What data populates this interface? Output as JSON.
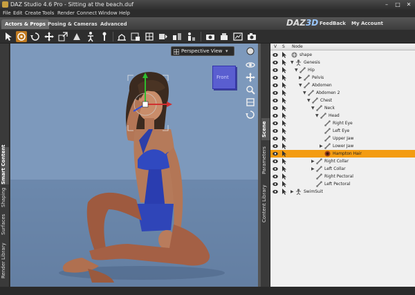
{
  "window": {
    "title": "DAZ Studio 4.6 Pro - Sitting at the beach.duf",
    "minimize": "–",
    "maximize": "□",
    "close": "✕"
  },
  "menu": [
    "File",
    "Edit",
    "Create",
    "Tools",
    "Render",
    "Connect",
    "Window",
    "Help"
  ],
  "tabs": [
    "Actors & Props",
    "Posing & Cameras",
    "Advanced"
  ],
  "logo": {
    "daz": "DAZ",
    "three": "3D"
  },
  "header_links": {
    "feedback": "FeedBack",
    "account": "My Account"
  },
  "left_tabs": [
    "Smart Content",
    "Shaping",
    "Surfaces",
    "Render Library"
  ],
  "viewport": {
    "camera": "Perspective View",
    "cube_label": "Front"
  },
  "panel_tabs": [
    "Scene",
    "Parameters",
    "Content Library"
  ],
  "scene": {
    "columns": {
      "v": "V",
      "s": "S",
      "node": "Node"
    },
    "nodes": [
      {
        "label": "shape",
        "depth": 0,
        "icon": "shape",
        "twisty": ""
      },
      {
        "label": "Genesis",
        "depth": 1,
        "icon": "figure",
        "twisty": "▼"
      },
      {
        "label": "Hip",
        "depth": 2,
        "icon": "bone",
        "twisty": "▼"
      },
      {
        "label": "Pelvis",
        "depth": 3,
        "icon": "bone",
        "twisty": "▶"
      },
      {
        "label": "Abdomen",
        "depth": 3,
        "icon": "bone",
        "twisty": "▼"
      },
      {
        "label": "Abdomen 2",
        "depth": 4,
        "icon": "bone",
        "twisty": "▼"
      },
      {
        "label": "Chest",
        "depth": 5,
        "icon": "bone",
        "twisty": "▼"
      },
      {
        "label": "Neck",
        "depth": 6,
        "icon": "bone",
        "twisty": "▼"
      },
      {
        "label": "Head",
        "depth": 7,
        "icon": "bone",
        "twisty": "▼"
      },
      {
        "label": "Right Eye",
        "depth": 8,
        "icon": "bone",
        "twisty": ""
      },
      {
        "label": "Left Eye",
        "depth": 8,
        "icon": "bone",
        "twisty": ""
      },
      {
        "label": "Upper Jaw",
        "depth": 8,
        "icon": "bone",
        "twisty": ""
      },
      {
        "label": "Lower Jaw",
        "depth": 8,
        "icon": "bone",
        "twisty": "▶"
      },
      {
        "label": "Hampton Hair",
        "depth": 8,
        "icon": "hair",
        "twisty": "",
        "selected": true
      },
      {
        "label": "Right Collar",
        "depth": 6,
        "icon": "bone",
        "twisty": "▶"
      },
      {
        "label": "Left Collar",
        "depth": 6,
        "icon": "bone",
        "twisty": "▶"
      },
      {
        "label": "Right Pectoral",
        "depth": 6,
        "icon": "bone",
        "twisty": ""
      },
      {
        "label": "Left Pectoral",
        "depth": 6,
        "icon": "bone",
        "twisty": ""
      },
      {
        "label": "SwimSuit",
        "depth": 1,
        "icon": "figure",
        "twisty": "▶"
      }
    ]
  },
  "colors": {
    "accent": "#f39c12",
    "viewport_bg": "#7d99bc",
    "cube": "#5a5ed0"
  }
}
